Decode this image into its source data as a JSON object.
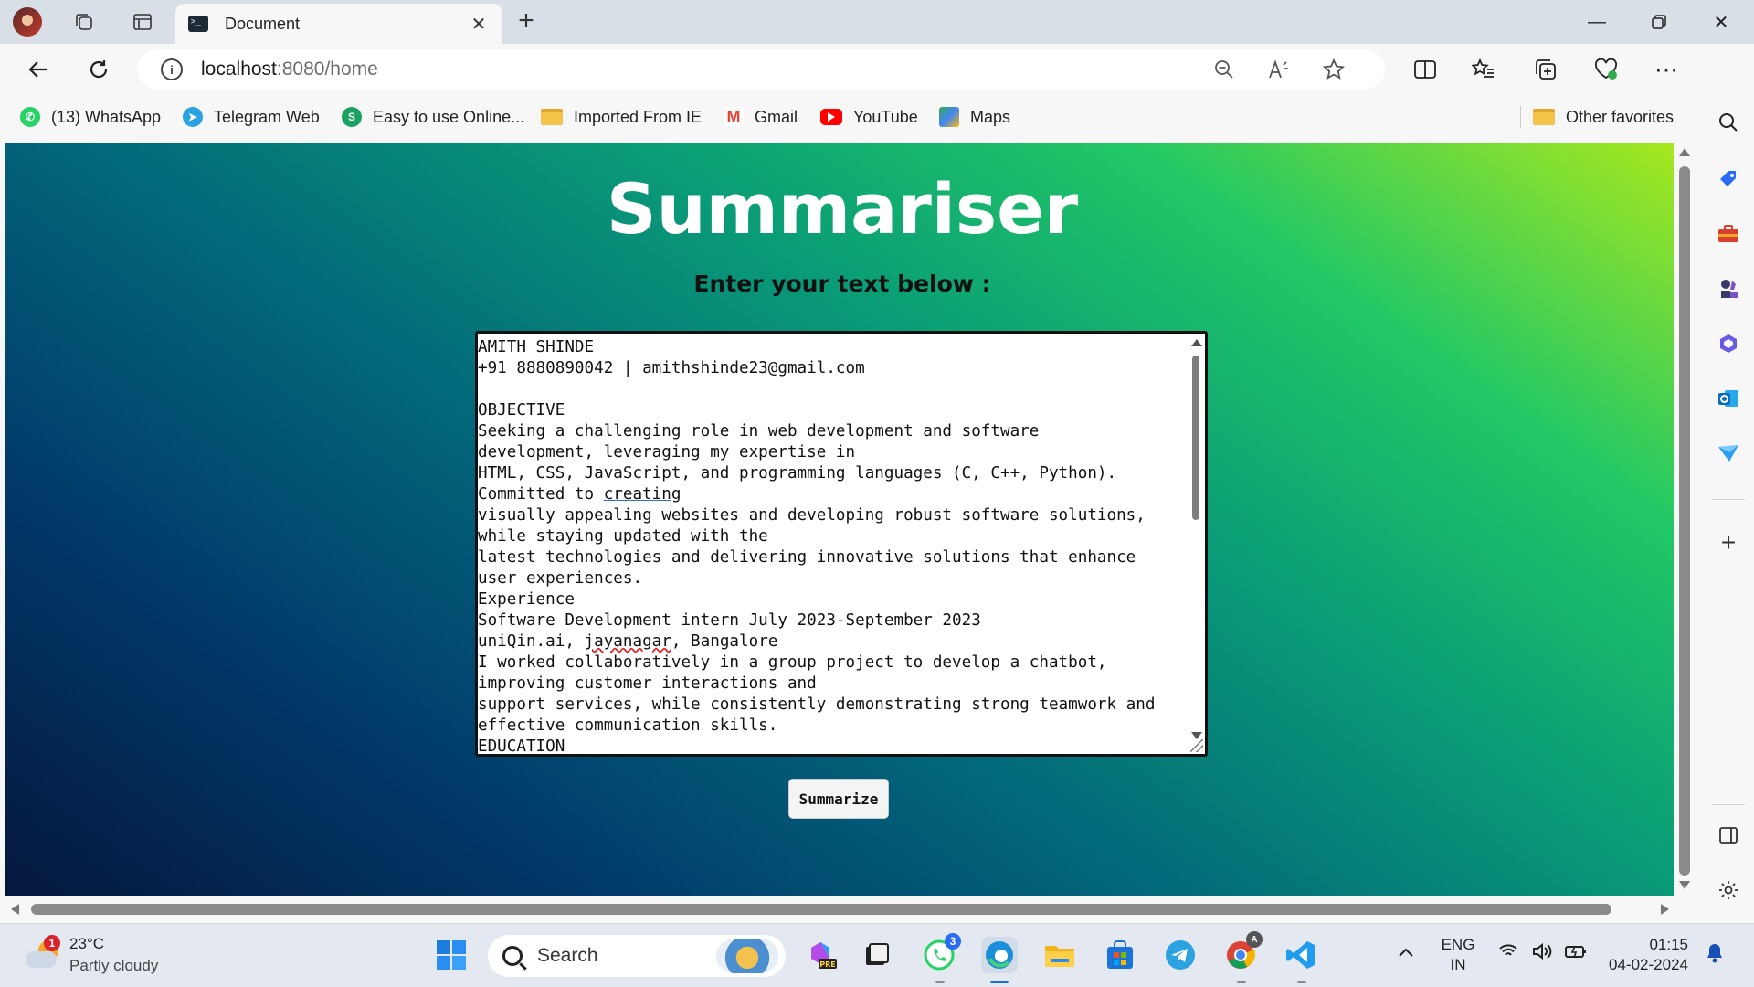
{
  "browser": {
    "tab_title": "Document",
    "url_host": "localhost",
    "url_path": ":8080/home"
  },
  "favorites": {
    "items": [
      {
        "label": "(13) WhatsApp",
        "icon": "whatsapp-icon"
      },
      {
        "label": "Telegram Web",
        "icon": "telegram-icon"
      },
      {
        "label": "Easy to use Online...",
        "icon": "skype-icon"
      },
      {
        "label": "Imported From IE",
        "icon": "folder-icon"
      },
      {
        "label": "Gmail",
        "icon": "gmail-icon"
      },
      {
        "label": "YouTube",
        "icon": "youtube-icon"
      },
      {
        "label": "Maps",
        "icon": "maps-icon"
      }
    ],
    "other": "Other favorites"
  },
  "page": {
    "title": "Summariser",
    "subtitle": "Enter your text below :",
    "textarea_lines": [
      "AMITH SHINDE",
      "+91 8880890042 | amithshinde23@gmail.com",
      "",
      "OBJECTIVE",
      "Seeking a challenging role in web development and software",
      "development, leveraging my expertise in",
      "HTML, CSS, JavaScript, and programming languages (C, C++, Python).",
      "Committed to creating",
      "visually appealing websites and developing robust software solutions,",
      "while staying updated with the",
      "latest technologies and delivering innovative solutions that enhance",
      "user experiences.",
      "Experience",
      "Software Development intern July 2023-September 2023",
      "uniQin.ai, jayanagar, Bangalore",
      "I worked collaboratively in a group project to develop a chatbot,",
      "improving customer interactions and",
      "support services, while consistently demonstrating strong teamwork and",
      "effective communication skills.",
      "EDUCATION"
    ],
    "button_label": "Summarize"
  },
  "taskbar": {
    "weather_temp": "23°C",
    "weather_cond": "Partly cloudy",
    "weather_badge": "1",
    "search_label": "Search",
    "whatsapp_badge": "3",
    "chrome_badge": "A",
    "lang_line1": "ENG",
    "lang_line2": "IN",
    "time": "01:15",
    "date": "04-02-2024"
  },
  "colors": {
    "gradient_dark": "#05173d",
    "gradient_mid": "#0a9c77",
    "gradient_light": "#a8e81e"
  }
}
